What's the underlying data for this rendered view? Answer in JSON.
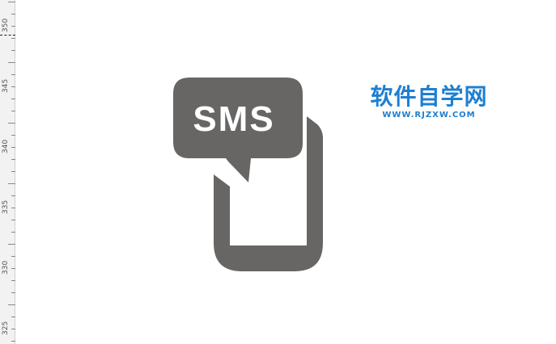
{
  "ruler": {
    "labels": [
      "350",
      "345",
      "340",
      "335",
      "330",
      "325"
    ]
  },
  "icon": {
    "name": "sms-phone-icon",
    "text": "SMS",
    "color": "#676665"
  },
  "watermark": {
    "title": "软件自学网",
    "url": "WWW.RJZXW.COM",
    "color": "#1e7fd0"
  }
}
